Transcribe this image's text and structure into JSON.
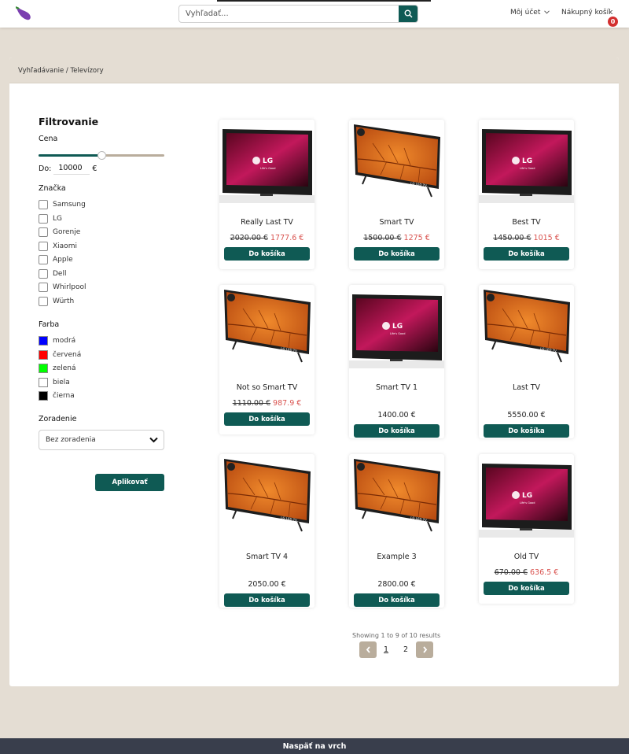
{
  "header": {
    "search_placeholder": "Vyhľadať...",
    "account_label": "Môj účet",
    "cart_label": "Nákupný košík",
    "cart_count": "0"
  },
  "breadcrumb": "Vyhľadávanie / Televízory",
  "filters": {
    "title": "Filtrovanie",
    "price": {
      "label": "Cena",
      "to_label": "Do:",
      "to_value": "10000",
      "currency": "€",
      "slider_fraction": 0.5
    },
    "brand": {
      "label": "Značka",
      "options": [
        "Samsung",
        "LG",
        "Gorenje",
        "Xiaomi",
        "Apple",
        "Dell",
        "Whirlpool",
        "Würth"
      ]
    },
    "color": {
      "label": "Farba",
      "options": [
        {
          "label": "modrá",
          "swatch": "#0000ff"
        },
        {
          "label": "červená",
          "swatch": "#ff0000"
        },
        {
          "label": "zelená",
          "swatch": "#00ff00"
        },
        {
          "label": "biela",
          "swatch": "#ffffff"
        },
        {
          "label": "čierna",
          "swatch": "#000000"
        }
      ]
    },
    "sort": {
      "label": "Zoradenie",
      "selected": "Bez zoradenia"
    },
    "apply_label": "Aplikovať"
  },
  "products": [
    {
      "name": "Really Last TV",
      "old_price": "2020.00 €",
      "new_price": "1777.6 €",
      "price": "",
      "image": "lg-black-tv",
      "button": "Do košíka"
    },
    {
      "name": "Smart TV",
      "old_price": "1500.00 €",
      "new_price": "1275 €",
      "price": "",
      "image": "lg-orange-tv",
      "button": "Do košíka"
    },
    {
      "name": "Best TV",
      "old_price": "1450.00 €",
      "new_price": "1015 €",
      "price": "",
      "image": "lg-black-tv",
      "button": "Do košíka"
    },
    {
      "name": "Not so Smart TV",
      "old_price": "1110.00 €",
      "new_price": "987.9 €",
      "price": "",
      "image": "lg-orange-tv",
      "button": "Do košíka"
    },
    {
      "name": "Smart TV 1",
      "old_price": "",
      "new_price": "",
      "price": "1400.00 €",
      "image": "lg-black-tv",
      "button": "Do košíka"
    },
    {
      "name": "Last TV",
      "old_price": "",
      "new_price": "",
      "price": "5550.00 €",
      "image": "lg-orange-tv",
      "button": "Do košíka"
    },
    {
      "name": "Smart TV 4",
      "old_price": "",
      "new_price": "",
      "price": "2050.00 €",
      "image": "lg-orange-tv",
      "button": "Do košíka"
    },
    {
      "name": "Example 3",
      "old_price": "",
      "new_price": "",
      "price": "2800.00 €",
      "image": "lg-orange-tv",
      "button": "Do košíka"
    },
    {
      "name": "Old TV",
      "old_price": "670.00 €",
      "new_price": "636.5 €",
      "price": "",
      "image": "lg-black-tv",
      "button": "Do košíka"
    }
  ],
  "pagination": {
    "showing_text": "Showing 1 to 9 of 10 results",
    "pages": [
      "1",
      "2"
    ],
    "current": "1",
    "prev_icon": "chevron-left-icon",
    "next_icon": "chevron-right-icon"
  },
  "footer": {
    "back_to_top": "Naspäť na vrch"
  },
  "colors": {
    "primary": "#0f5a54",
    "background": "#e4ddd3",
    "accent_tan": "#b9ad9c",
    "sale_red": "#d9534f",
    "footer": "#393e4c",
    "badge": "#d32f2f"
  }
}
